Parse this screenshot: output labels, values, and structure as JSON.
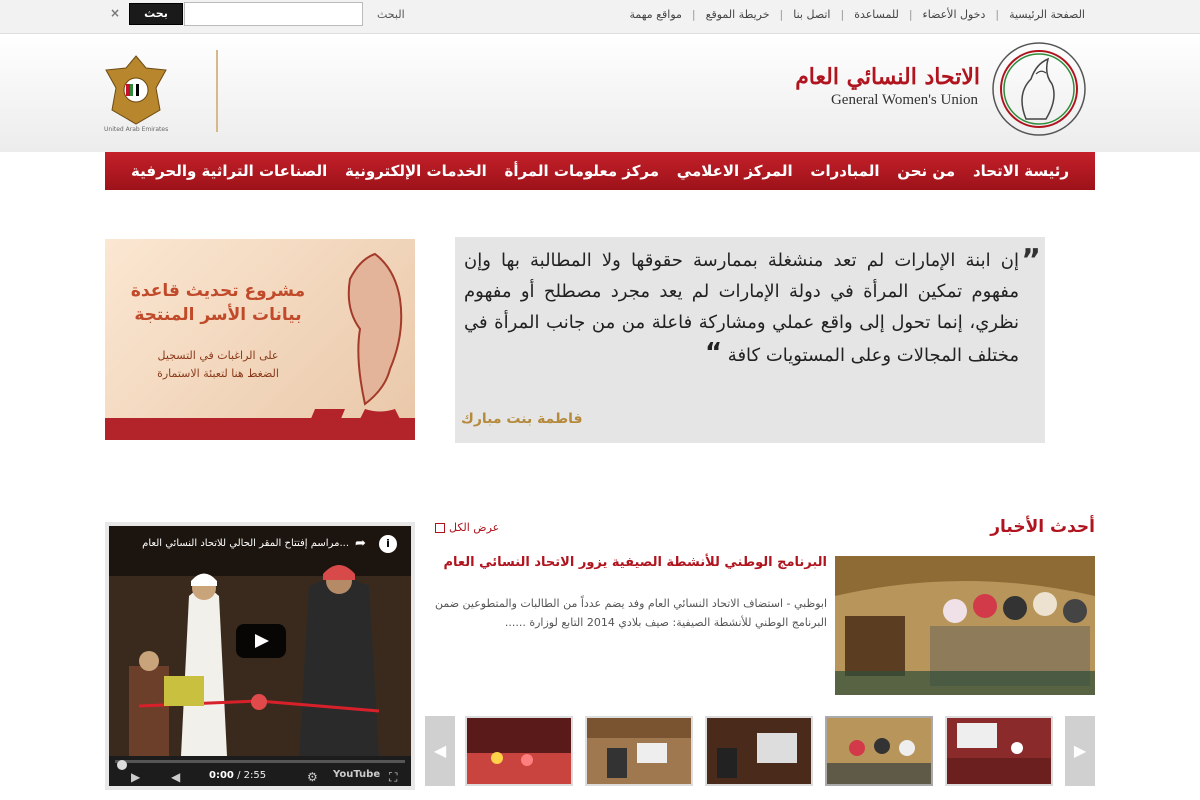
{
  "topbar": {
    "links": [
      "الصفحة الرئيسية",
      "دخول الأعضاء",
      "للمساعدة",
      "اتصل بنا",
      "خريطة الموقع",
      "مواقع مهمة"
    ],
    "search_label": "البحث",
    "search_button": "بحث",
    "close": "×"
  },
  "header": {
    "org_name_ar": "الاتحاد النسائي العام",
    "org_name_en": "General Women's Union",
    "uae_caption": "United Arab Emirates"
  },
  "nav": {
    "items": [
      "رئيسة الاتحاد",
      "من نحن",
      "المبادرات",
      "المركز الاعلامي",
      "مركز معلومات المرأة",
      "الخدمات الإلكترونية",
      "الصناعات التراثية والحرفية"
    ]
  },
  "quote": {
    "open_mark": "”",
    "text": "إن ابنة الإمارات لم تعد منشغلة بممارسة حقوقها ولا المطالبة بها وإن مفهوم تمكين المرأة في دولة الإمارات لم يعد مجرد مصطلح أو مفهوم نظري، إنما تحول إلى واقع عملي ومشاركة فاعلة من من جانب المرأة في مختلف المجالات وعلى المستويات كافة",
    "close_mark": "“",
    "author": "فاطمة بنت مبارك"
  },
  "promo": {
    "title": "مشروع تحديث قاعدة بيانات الأسر المنتجة",
    "subtitle_1": "على الراغبات في التسجيل",
    "subtitle_2": "الضغط هنا لتعبئة الاستمارة"
  },
  "news": {
    "section_title": "أحدث الأخبار",
    "view_all": "عرض الكل",
    "headline": "البرنامج الوطني للأنشطة الصيفية يزور الاتحاد النسائي العام",
    "body": "ابوظبي -  استضاف الاتحاد النسائي العام وفد يضم عدداً من الطالبات والمتطوعين ضمن البرنامج الوطني للأنشطة الصيفية: صيف بلادي 2014 التابع لوزارة ......",
    "arrow_prev": "◀",
    "arrow_next": "▶"
  },
  "video": {
    "title": "...مراسم إفتتاح المقر الحالي للاتحاد النسائي العام",
    "info_icon": "i",
    "current_time": "0:00",
    "duration": "/ 2:55",
    "yt_label": "YouTube",
    "progress": 0.0
  },
  "colors": {
    "brand_red": "#b0141e",
    "nav_red": "#c4202a",
    "gold": "#b58a3c"
  }
}
